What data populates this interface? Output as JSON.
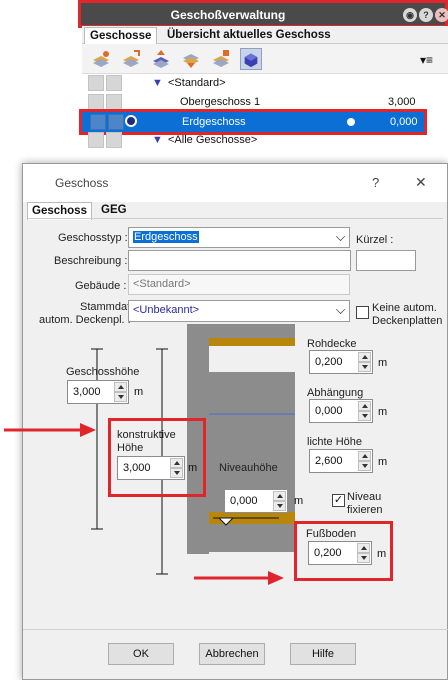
{
  "panel": {
    "title": "Geschoßverwaltung",
    "tabs": [
      "Geschosse",
      "Übersicht aktuelles Geschoss"
    ],
    "rows": [
      {
        "label": "<Standard>",
        "value": ""
      },
      {
        "label": "Obergeschoss 1",
        "value": "3,000"
      },
      {
        "label": "Erdgeschoss",
        "value": "0,000"
      },
      {
        "label": "<Alle Geschosse>",
        "value": ""
      }
    ]
  },
  "dialog": {
    "title": "Geschoss",
    "help": "?",
    "close": "✕",
    "tabs": [
      "Geschoss",
      "GEG"
    ],
    "geschosstyp_label": "Geschosstyp :",
    "geschosstyp_value": "Erdgeschoss",
    "kuerzel_label": "Kürzel :",
    "beschreibung_label": "Beschreibung :",
    "gebaeude_label": "Gebäude :",
    "gebaeude_value": "<Standard>",
    "stammdaten_label1": "Stammdaten",
    "stammdaten_label2": "autom. Deckenpl. :",
    "stammdaten_value": "<Unbekannt>",
    "keine_autom_1": "Keine autom.",
    "keine_autom_2": "Deckenplatten",
    "geschosshoehe_label": "Geschosshöhe",
    "geschosshoehe_value": "3,000",
    "konstruktive_label1": "konstruktive",
    "konstruktive_label2": "Höhe",
    "konstruktive_value": "3,000",
    "rohdecke_label": "Rohdecke",
    "rohdecke_value": "0,200",
    "abhaengung_label": "Abhängung",
    "abhaengung_value": "0,000",
    "lichte_label": "lichte Höhe",
    "lichte_value": "2,600",
    "niveauhoehe_label": "Niveauhöhe",
    "niveauhoehe_value": "0,000",
    "niveau_fix_1": "Niveau",
    "niveau_fix_2": "fixieren",
    "fussboden_label": "Fußboden",
    "fussboden_value": "0,200",
    "unit": "m",
    "ok": "OK",
    "abbrechen": "Abbrechen",
    "hilfe": "Hilfe"
  },
  "colors": {
    "highlight": "#e0252b",
    "selection": "#0b6fd6",
    "title_bar": "#4a4a4a",
    "wall": "#8c8c8c",
    "floor": "#b8860b"
  }
}
